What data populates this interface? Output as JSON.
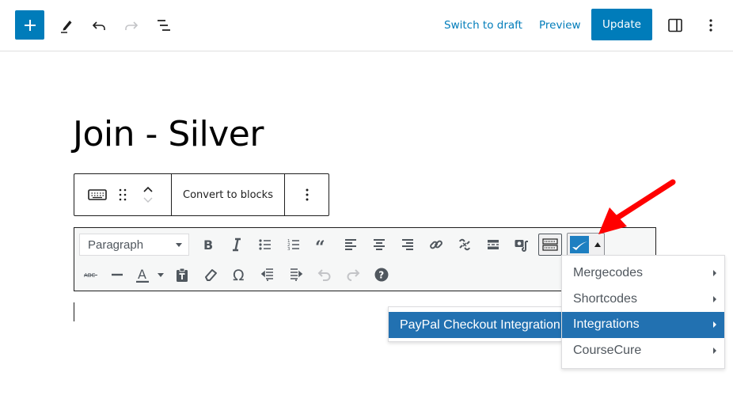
{
  "header": {
    "add_block_icon": "plus-icon",
    "tools_icon": "pencil-icon",
    "undo_icon": "undo-icon",
    "redo_icon": "redo-icon",
    "list_view_icon": "list-view-icon",
    "switch_to_draft_label": "Switch to draft",
    "preview_label": "Preview",
    "update_label": "Update",
    "settings_icon": "sidebar-toggle-icon",
    "options_icon": "more-vertical-icon"
  },
  "post": {
    "title": "Join - Silver"
  },
  "block_toolbar": {
    "block_type_icon": "keyboard-icon",
    "drag_icon": "drag-handle-icon",
    "move_up_icon": "chevron-up-icon",
    "move_down_icon": "chevron-down-icon",
    "convert_label": "Convert to blocks",
    "options_icon": "more-vertical-icon"
  },
  "classic_toolbar": {
    "format_select": {
      "value": "Paragraph"
    },
    "row1": [
      "bold",
      "italic",
      "bulleted-list",
      "numbered-list",
      "blockquote",
      "align-left",
      "align-center",
      "align-right",
      "insert-link",
      "remove-link",
      "read-more",
      "add-media",
      "toolbar-toggle",
      "plugin-menu"
    ],
    "row2": [
      "strikethrough",
      "horizontal-line",
      "text-color",
      "paste-as-text",
      "clear-formatting",
      "special-character",
      "decrease-indent",
      "increase-indent",
      "undo",
      "redo",
      "keyboard-shortcuts"
    ],
    "colors": {
      "icon": "#50575e",
      "disabled": "#c3c4c7",
      "plugin_logo": "#1e7fc1"
    }
  },
  "plugin_menu": {
    "items": [
      {
        "label": "Mergecodes",
        "has_submenu": true
      },
      {
        "label": "Shortcodes",
        "has_submenu": true
      },
      {
        "label": "Integrations",
        "has_submenu": true,
        "active": true
      },
      {
        "label": "CourseCure",
        "has_submenu": true
      }
    ],
    "submenu": {
      "items": [
        {
          "label": "PayPal Checkout Integration",
          "active": true
        }
      ]
    },
    "highlight_color": "#2271b1"
  },
  "annotation": {
    "type": "red-arrow",
    "color": "#ff0000",
    "points_to": "plugin-menu-button"
  },
  "accent_color": "#007cba"
}
